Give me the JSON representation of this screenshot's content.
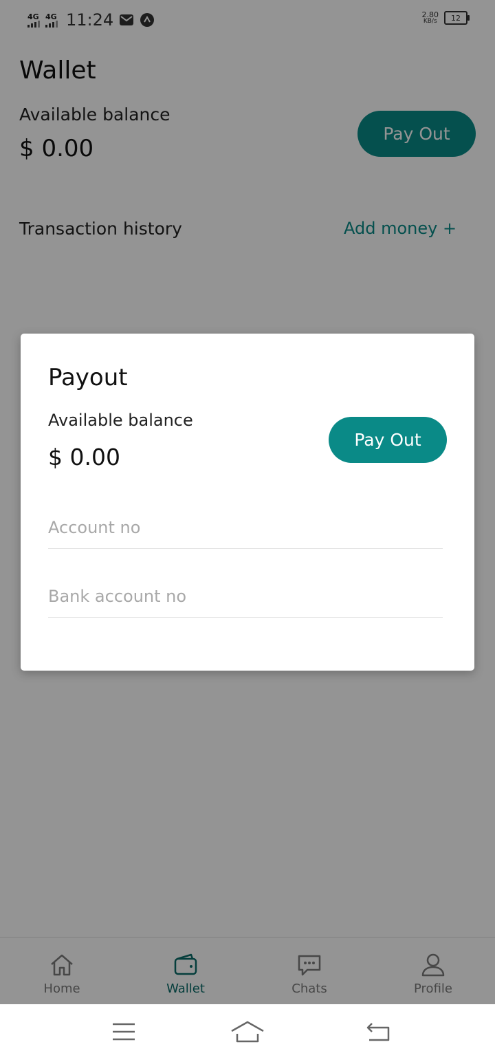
{
  "status_bar": {
    "network_1": "4G",
    "network_2": "4G",
    "time": "11:24",
    "speed_value": "2.80",
    "speed_unit": "KB/s",
    "battery": "12"
  },
  "page": {
    "title": "Wallet",
    "balance_label": "Available balance",
    "balance_value": "$ 0.00",
    "payout_button": "Pay Out",
    "history_label": "Transaction history",
    "add_money": "Add money +"
  },
  "dialog": {
    "title": "Payout",
    "balance_label": "Available balance",
    "balance_value": "$ 0.00",
    "payout_button": "Pay Out",
    "account_placeholder": "Account no",
    "bank_placeholder": "Bank account no"
  },
  "bottom_nav": {
    "items": [
      {
        "label": "Home",
        "icon": "home-icon"
      },
      {
        "label": "Wallet",
        "icon": "wallet-icon",
        "active": true
      },
      {
        "label": "Chats",
        "icon": "chat-icon"
      },
      {
        "label": "Profile",
        "icon": "profile-icon"
      }
    ]
  },
  "colors": {
    "accent": "#0a8a87",
    "accent_dark": "#0a6b68",
    "overlay": "rgba(0,0,0,0.42)"
  }
}
